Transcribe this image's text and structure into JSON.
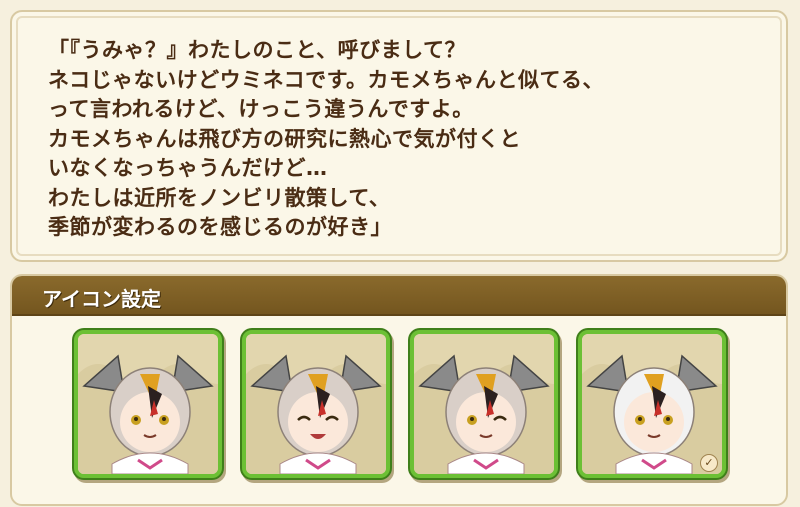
{
  "quote": {
    "lines": [
      "「『うみゃ？』わたしのこと、呼びまして？",
      "ネコじゃないけどウミネコです。カモメちゃんと似てる、",
      "って言われるけど、けっこう違うんですよ。",
      "カモメちゃんは飛び方の研究に熱心で気が付くと",
      "いなくなっちゃうんだけど…",
      "わたしは近所をノンビリ散策して、",
      "季節が変わるのを感じるのが好き」"
    ]
  },
  "icon_settings": {
    "title": "アイコン設定",
    "icons": [
      {
        "name": "icon-smile",
        "expression": "smile",
        "hair": "#d9cfc8",
        "selected": false
      },
      {
        "name": "icon-laugh",
        "expression": "laugh",
        "hair": "#d9cfc8",
        "selected": false
      },
      {
        "name": "icon-wink",
        "expression": "wink",
        "hair": "#d9cfc8",
        "selected": false
      },
      {
        "name": "icon-casual",
        "expression": "smile",
        "hair": "#f2f2f2",
        "selected": true
      }
    ],
    "frame_color": "#6cc035"
  }
}
